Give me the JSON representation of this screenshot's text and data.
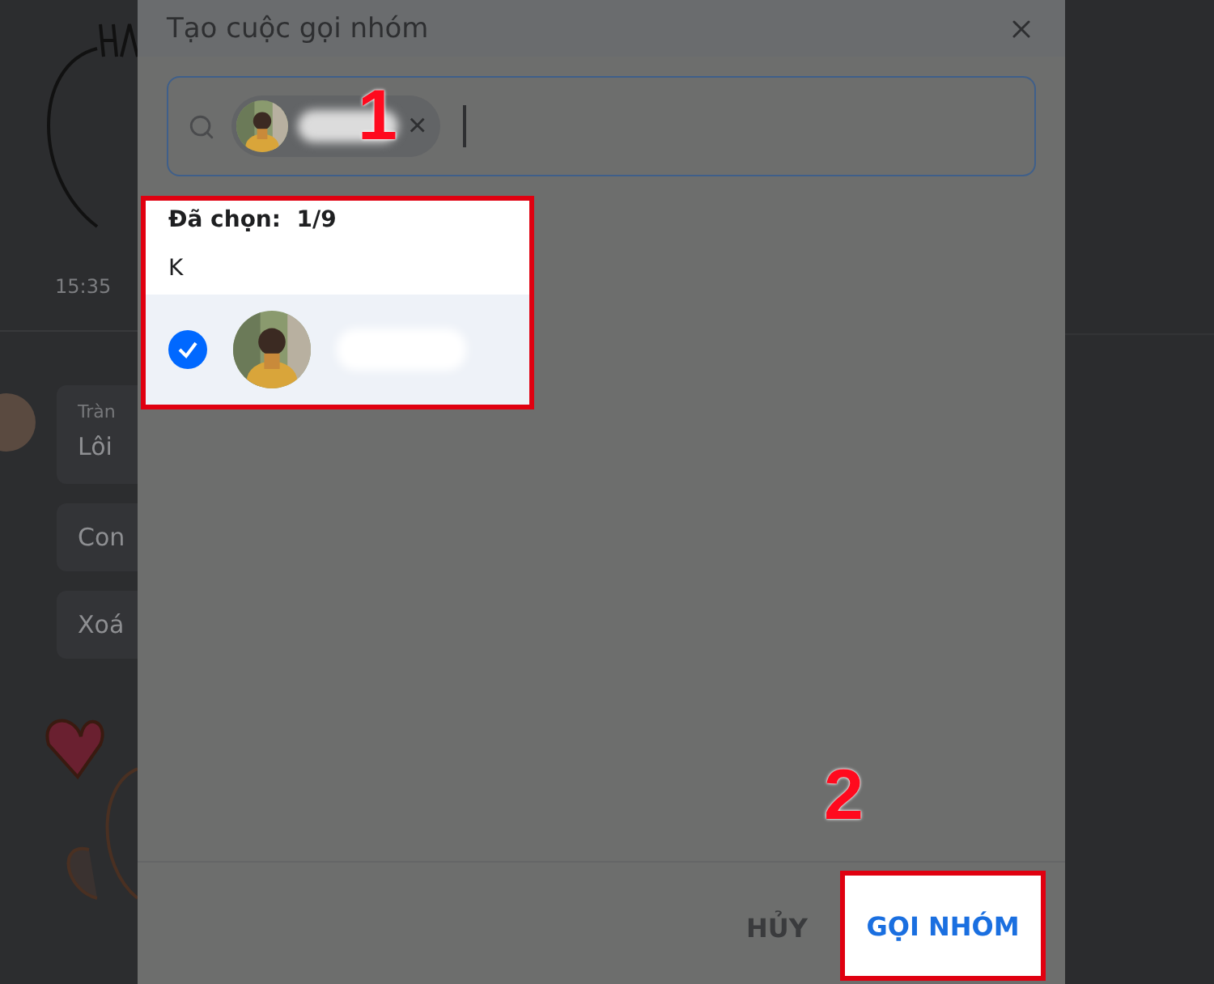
{
  "chat_background": {
    "time": "15:35",
    "sender": "Tràn",
    "messages": [
      "Lôi",
      "Con",
      "Xoá"
    ]
  },
  "dialog": {
    "title": "Tạo cuộc gọi nhóm",
    "search": {
      "chips": [
        {
          "remove": "×"
        }
      ]
    },
    "selected_count": {
      "label": "Đã chọn:",
      "value": "1/9"
    },
    "section": "K",
    "contacts": [
      {
        "selected": true
      }
    ],
    "buttons": [
      {
        "kind": "cancel",
        "label": "HỦY"
      },
      {
        "kind": "confirm",
        "label": "GỌI NHÓM"
      }
    ]
  },
  "annotations": [
    {
      "label": "1"
    },
    {
      "label": "2"
    }
  ]
}
